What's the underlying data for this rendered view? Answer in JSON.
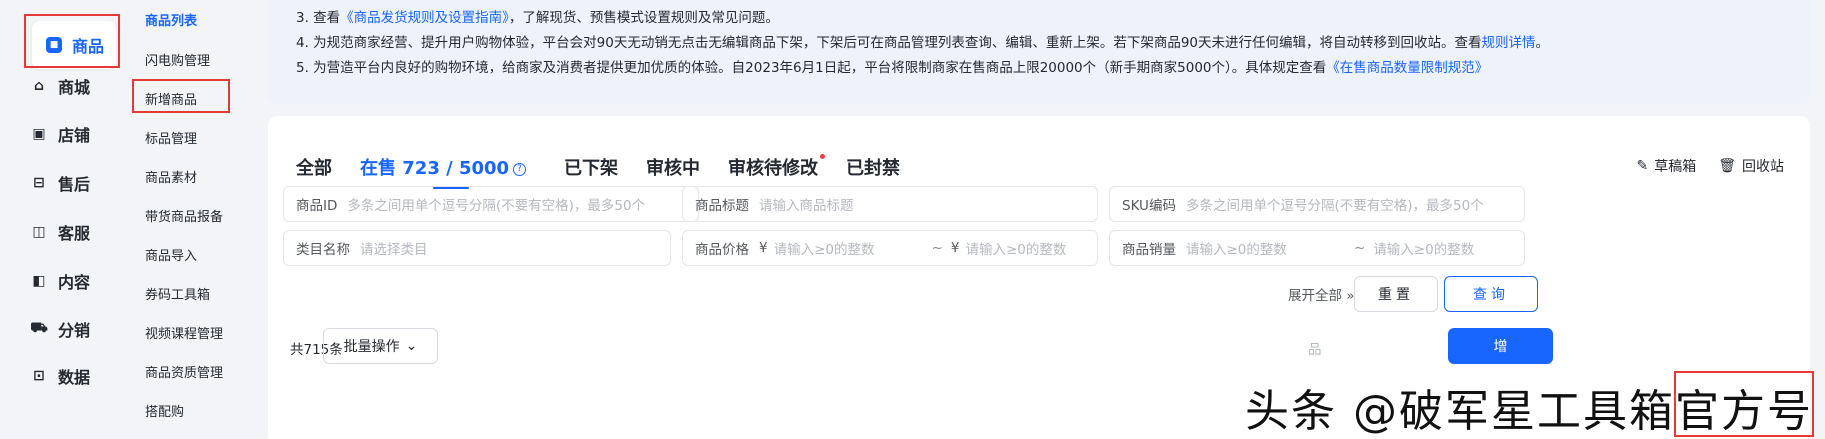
{
  "rail": {
    "items": [
      {
        "label": "商品",
        "icon": "bag-icon"
      },
      {
        "label": "商城",
        "icon": "home-icon"
      },
      {
        "label": "店铺",
        "icon": "store-icon"
      },
      {
        "label": "售后",
        "icon": "aftersale-icon"
      },
      {
        "label": "客服",
        "icon": "chat-icon"
      },
      {
        "label": "内容",
        "icon": "book-icon"
      },
      {
        "label": "分销",
        "icon": "cart-icon"
      },
      {
        "label": "数据",
        "icon": "chart-icon"
      }
    ]
  },
  "submenu": {
    "header": "商品列表",
    "items": [
      "闪电购管理",
      "新增商品",
      "标品管理",
      "商品素材",
      "带货商品报备",
      "商品导入",
      "券码工具箱",
      "视频课程管理",
      "商品资质管理",
      "搭配购"
    ]
  },
  "notice": {
    "line3_a": "3. 查看",
    "line3_link": "《商品发货规则及设置指南》",
    "line3_b": "，了解现货、预售模式设置规则及常见问题。",
    "line4_a": "4. 为规范商家经营、提升用户购物体验，平台会对90天无动销无点击无编辑商品下架，下架后可在商品管理列表查询、编辑、重新上架。若下架商品90天未进行任何编辑，将自动转移到回收站。查看",
    "line4_link": "规则详情",
    "line4_b": "。",
    "line5_a": "5. 为营造平台内良好的购物环境，给商家及消费者提供更加优质的体验。自2023年6月1日起，平台将限制商家在售商品上限20000个（新手期商家5000个）。具体规定查看",
    "line5_link": "《在售商品数量限制规范》"
  },
  "tabs": {
    "all": "全部",
    "on_sale": "在售 723 / 5000",
    "off_shelf": "已下架",
    "reviewing": "审核中",
    "pending_edit": "审核待修改",
    "banned": "已封禁"
  },
  "top_actions": {
    "drafts": "草稿箱",
    "recycle": "回收站"
  },
  "filters": {
    "product_id": {
      "label": "商品ID",
      "placeholder": "多条之间用单个逗号分隔(不要有空格)，最多50个"
    },
    "title": {
      "label": "商品标题",
      "placeholder": "请输入商品标题"
    },
    "sku": {
      "label": "SKU编码",
      "placeholder": "多条之间用单个逗号分隔(不要有空格)，最多50个"
    },
    "category": {
      "label": "类目名称",
      "placeholder": "请选择类目"
    },
    "price": {
      "label": "商品价格",
      "currency": "¥",
      "min_placeholder": "请输入≥0的整数",
      "sep": "~",
      "max_placeholder": "请输入≥0的整数"
    },
    "sales": {
      "label": "商品销量",
      "min_placeholder": "请输入≥0的整数",
      "sep": "~",
      "max_placeholder": "请输入≥0的整数"
    }
  },
  "actions": {
    "expand": "展开全部",
    "reset": "重置",
    "query": "查询"
  },
  "list": {
    "total": "共715条",
    "batch": "批量操作",
    "ghost": "品",
    "add": "增"
  },
  "watermark": "头条 @破军星工具箱官方号",
  "colors": {
    "accent": "#1966ff",
    "highlight": "#e53935"
  }
}
